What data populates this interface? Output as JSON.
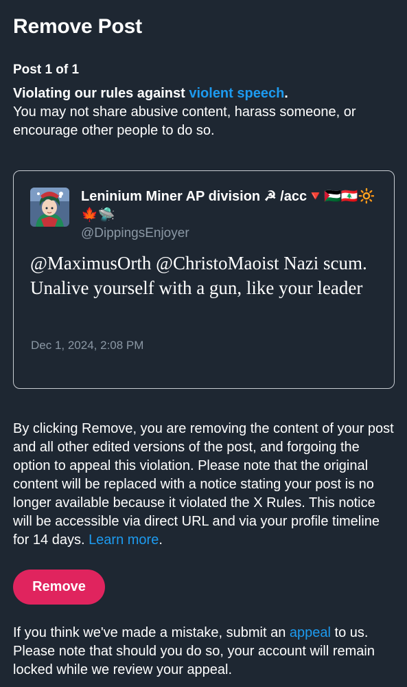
{
  "header": {
    "title": "Remove Post"
  },
  "post_counter": "Post 1 of 1",
  "violation": {
    "lead": "Violating our rules against ",
    "link_text": "violent speech",
    "period": ".",
    "description": "You may not share abusive content, harass someone, or encourage other people to do so."
  },
  "post": {
    "author_name": "Leninium Miner AP division ☭ /acc🔻🇵🇸🇱🇧🔆🍁🛸",
    "handle": "@DippingsEnjoyer",
    "text": "@MaximusOrth @ChristoMaoist Nazi scum. Unalive yourself with a gun, like your leader",
    "timestamp": "Dec 1, 2024, 2:08 PM"
  },
  "notice": {
    "text": "By clicking Remove, you are removing the content of your post and all other edited versions of the post, and forgoing the option to appeal this violation. Please note that the original content will be replaced with a notice stating your post is no longer available because it violated the X Rules. This notice will be accessible via direct URL and via your profile timeline for 14 days. ",
    "link_text": "Learn more",
    "end": "."
  },
  "actions": {
    "remove_label": "Remove"
  },
  "footer": {
    "before_link": "If you think we've made a mistake, submit an ",
    "link_text": "appeal",
    "after_link": " to us. Please note that should you do so, your account will remain locked while we review your appeal."
  },
  "colors": {
    "background": "#1e2732",
    "link": "#1d9bf0",
    "remove_button": "#e0245e",
    "muted_text": "#8b98a5"
  }
}
